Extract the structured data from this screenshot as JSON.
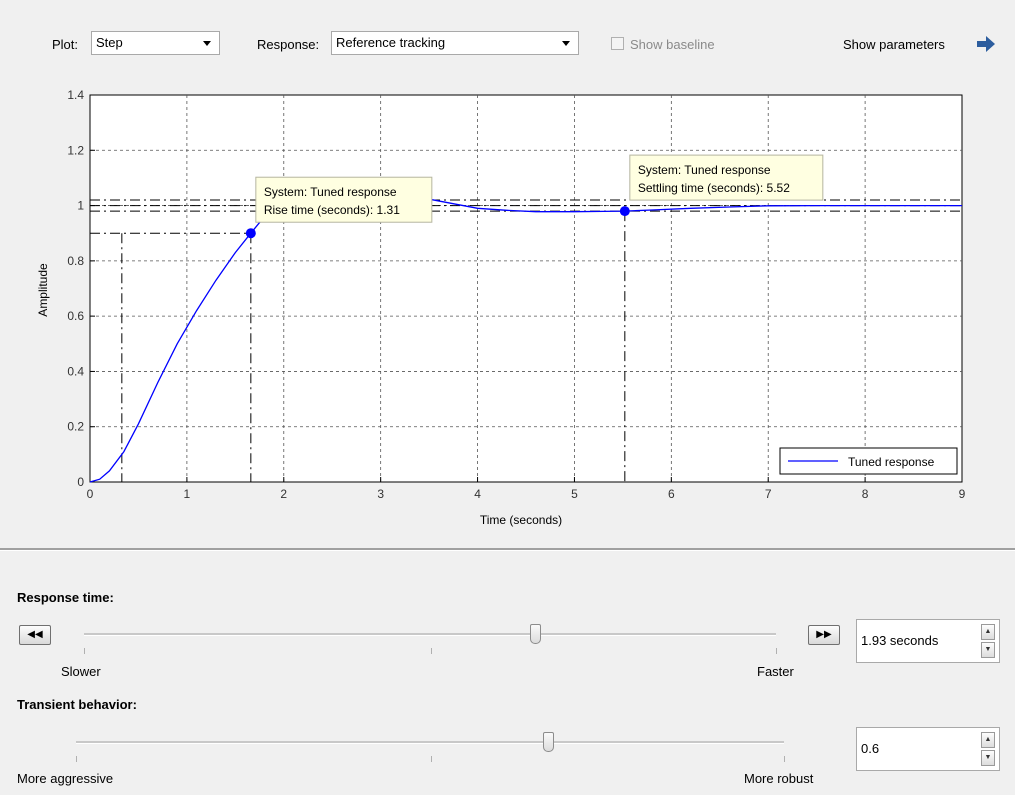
{
  "toolbar": {
    "plot_label": "Plot:",
    "plot_value": "Step",
    "response_label": "Response:",
    "response_value": "Reference tracking",
    "baseline_label": "Show baseline",
    "show_params_label": "Show parameters"
  },
  "chart_data": {
    "type": "line",
    "ylabel": "Amplitude",
    "xlabel": "Time (seconds)",
    "xlim": [
      0,
      9
    ],
    "ylim": [
      0,
      1.4
    ],
    "x_ticks": [
      "0",
      "1",
      "2",
      "3",
      "4",
      "5",
      "6",
      "7",
      "8",
      "9"
    ],
    "y_ticks": [
      "0",
      "0.2",
      "0.4",
      "0.6",
      "0.8",
      "1",
      "1.2",
      "1.4"
    ],
    "grid": true,
    "legend_position": "bottom-right",
    "series": [
      {
        "name": "Tuned response",
        "color": "#0000ff",
        "x": [
          0,
          0.1,
          0.2,
          0.35,
          0.5,
          0.7,
          0.9,
          1.1,
          1.3,
          1.5,
          1.66,
          1.8,
          2.0,
          2.2,
          2.5,
          2.8,
          3.1,
          3.4,
          3.7,
          4.0,
          4.3,
          4.6,
          5.0,
          5.3,
          5.52,
          5.8,
          6.2,
          6.6,
          7.0,
          7.5,
          8.0,
          8.5,
          9.0
        ],
        "y": [
          0,
          0.01,
          0.04,
          0.11,
          0.21,
          0.36,
          0.5,
          0.62,
          0.73,
          0.83,
          0.9,
          0.96,
          1.0,
          1.03,
          1.045,
          1.045,
          1.04,
          1.03,
          1.01,
          0.99,
          0.983,
          0.978,
          0.978,
          0.979,
          0.98,
          0.984,
          0.99,
          0.995,
          0.999,
          1.0,
          1.0,
          1.0,
          1.0
        ]
      }
    ],
    "reference_lines": {
      "final_value": 1.0,
      "settle_band": [
        0.98,
        1.02
      ],
      "rise_low": 0.1,
      "rise_high": 0.9
    },
    "markers": [
      {
        "x": 1.66,
        "y": 0.9,
        "line1": "System: Tuned response",
        "line2": "Rise time (seconds): 1.31"
      },
      {
        "x": 5.52,
        "y": 0.98,
        "line1": "System: Tuned response",
        "line2": "Settling time (seconds): 5.52"
      }
    ]
  },
  "tuning": {
    "response_time": {
      "title": "Response time:",
      "left_label": "Slower",
      "right_label": "Faster",
      "value": "1.93 seconds",
      "position_fraction": 0.655
    },
    "transient": {
      "title": "Transient behavior:",
      "left_label": "More aggressive",
      "right_label": "More robust",
      "value": "0.6",
      "position_fraction": 0.67
    }
  },
  "colors": {
    "series": "#0000ff",
    "arrow": "#2c5d9e",
    "tooltip_bg": "#ffffe1"
  }
}
